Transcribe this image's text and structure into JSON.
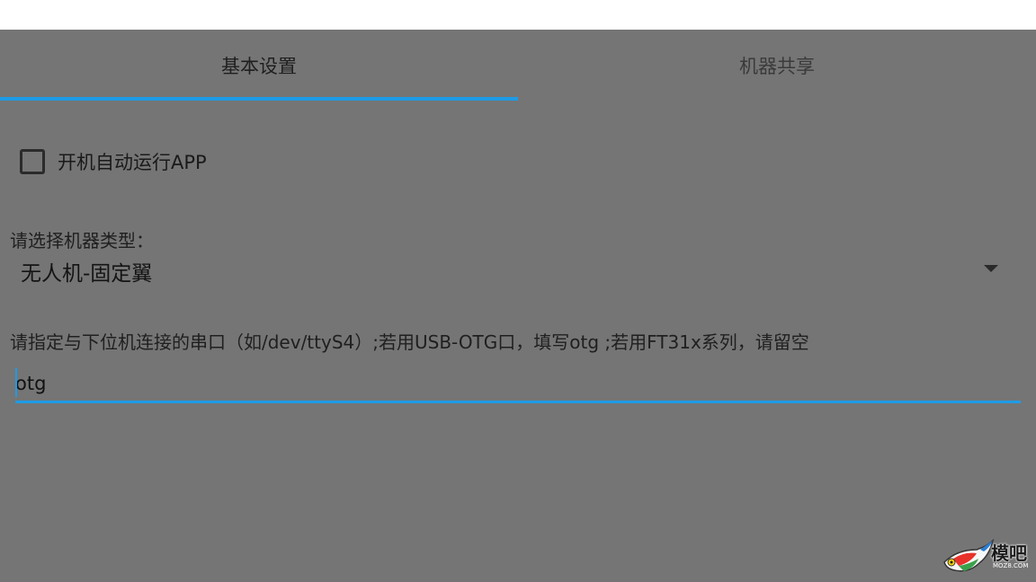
{
  "tabs": [
    {
      "label": "基本设置",
      "selected": true
    },
    {
      "label": "机器共享",
      "selected": false
    }
  ],
  "colors": {
    "panel_bg": "#757575",
    "accent": "#1e9be6",
    "topbar_bg": "#ffffff"
  },
  "autostart": {
    "label": "开机自动运行APP",
    "checked": false
  },
  "machine_type": {
    "label": "请选择机器类型：",
    "value": "无人机-固定翼",
    "icon": "dropdown-arrow-icon"
  },
  "serial_port": {
    "label": "请指定与下位机连接的串口（如/dev/ttyS4）;若用USB-OTG口，填写otg ;若用FT31x系列，请留空",
    "value": "otg"
  },
  "watermark": {
    "text": "模吧",
    "sub": "MOZ8.COM"
  }
}
